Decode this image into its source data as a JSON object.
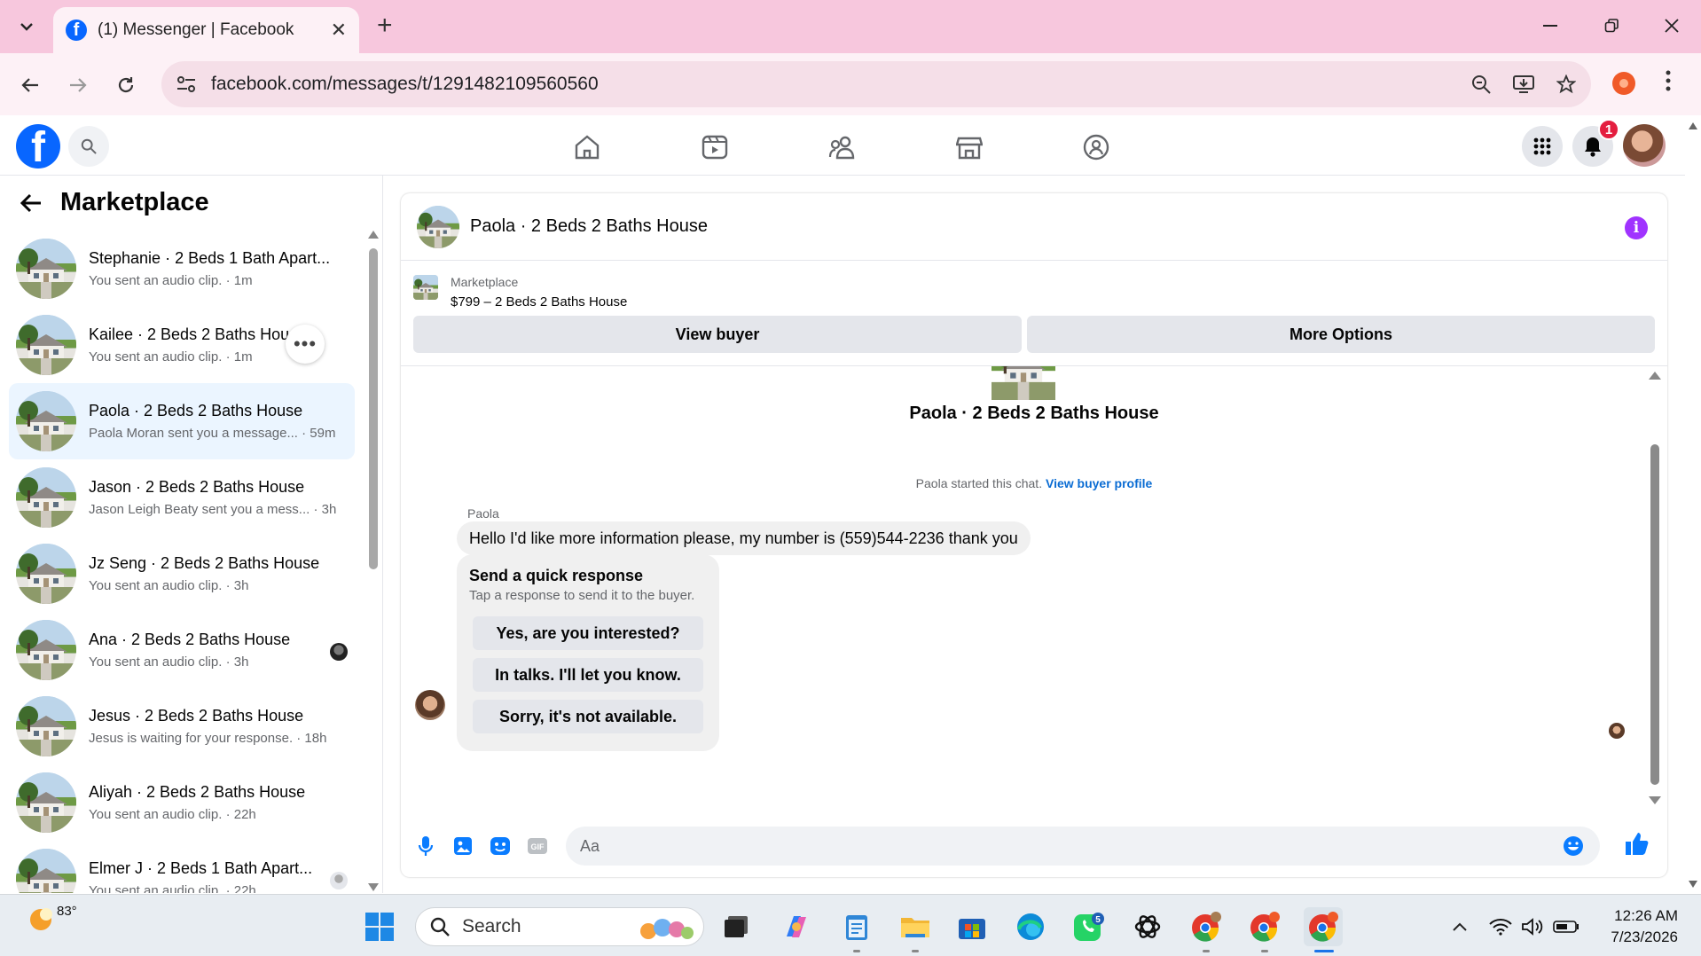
{
  "browser": {
    "tab_title": "(1) Messenger | Facebook",
    "url": "facebook.com/messages/t/1291482109560560"
  },
  "fb": {
    "notification_count": "1"
  },
  "sidebar": {
    "title": "Marketplace",
    "conversations": [
      {
        "name": "Stephanie · 2 Beds 1 Bath Apart...",
        "preview": "You sent an audio clip. · 1m"
      },
      {
        "name": "Kailee · 2 Beds 2 Baths House",
        "preview": "You sent an audio clip. · 1m"
      },
      {
        "name": "Paola · 2 Beds 2 Baths House",
        "preview": "Paola Moran sent you a message... · 59m"
      },
      {
        "name": "Jason · 2 Beds 2 Baths House",
        "preview": "Jason Leigh Beaty sent you a mess... · 3h"
      },
      {
        "name": "Jz Seng · 2 Beds 2 Baths House",
        "preview": "You sent an audio clip. · 3h"
      },
      {
        "name": "Ana · 2 Beds 2 Baths House",
        "preview": "You sent an audio clip. · 3h"
      },
      {
        "name": "Jesus · 2 Beds 2 Baths House",
        "preview": "Jesus is waiting for your response. · 18h"
      },
      {
        "name": "Aliyah · 2 Beds 2 Baths House",
        "preview": "You sent an audio clip. · 22h"
      },
      {
        "name": "Elmer J · 2 Beds 1 Bath Apart...",
        "preview": "You sent an audio clip. · 22h"
      }
    ],
    "more_label": "•••"
  },
  "chat": {
    "header_title": "Paola · 2 Beds 2 Baths House",
    "listing_label": "Marketplace",
    "listing_price": "$799 – 2 Beds 2 Baths House",
    "view_buyer": "View buyer",
    "more_options": "More Options",
    "conv_title": "Paola · 2 Beds 2 Baths House",
    "started_text": "Paola started this chat.",
    "view_buyer_profile": "View buyer profile",
    "sender_name": "Paola",
    "message": "Hello I'd like more information please, my number is (559)544-2236 thank you",
    "quick_title": "Send a quick response",
    "quick_sub": "Tap a response to send it to the buyer.",
    "quick_responses": [
      "Yes, are you interested?",
      "In talks. I'll let you know.",
      "Sorry, it's not available."
    ],
    "composer_placeholder": "Aa"
  },
  "taskbar": {
    "temperature": "83°",
    "search_placeholder": "Search",
    "whatsapp_badge": "5",
    "time": "12:26 AM",
    "date": "7/23/2026"
  },
  "colors": {
    "facebook_blue": "#0866ff",
    "messenger_blue": "#0a7cff",
    "info_purple": "#a033ff",
    "tab_bar_pink": "#f7c7dd",
    "active_conv": "#ebf5ff"
  }
}
